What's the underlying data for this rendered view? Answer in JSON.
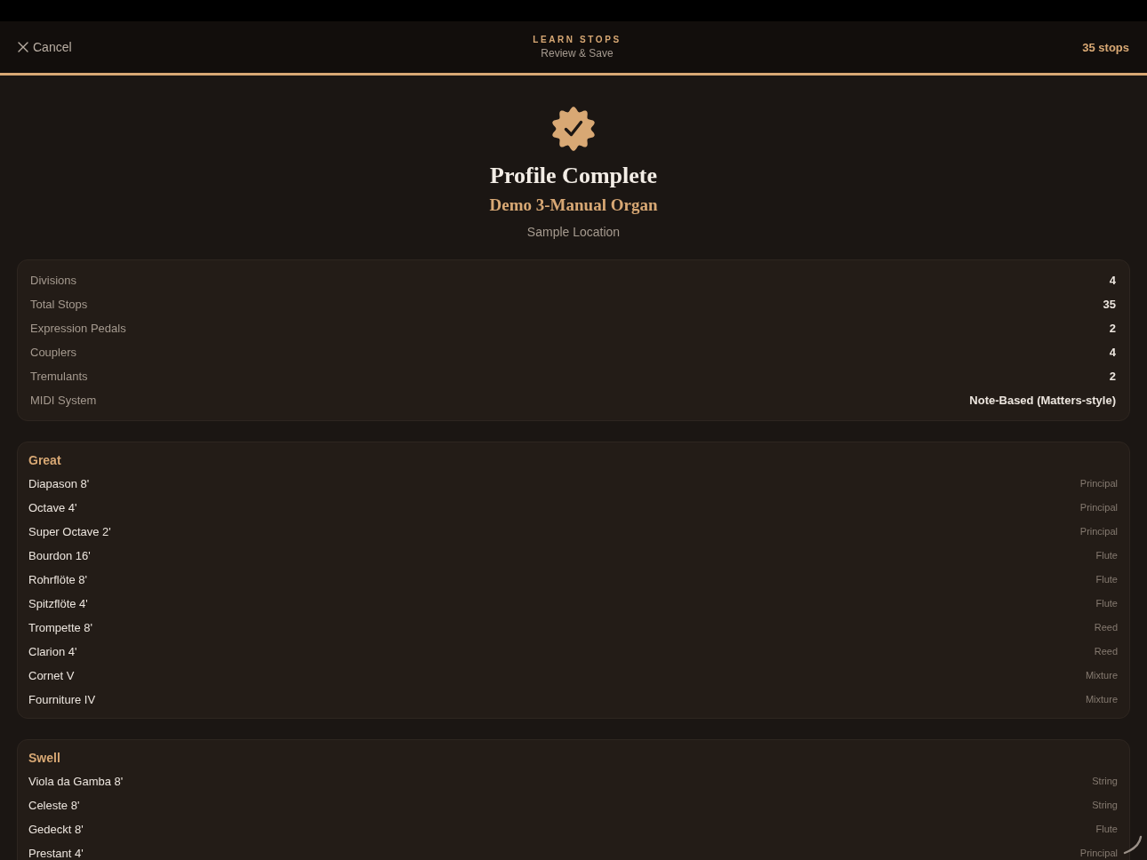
{
  "header": {
    "cancel": "Cancel",
    "title": "LEARN STOPS",
    "subtitle": "Review & Save",
    "count": "35 stops"
  },
  "hero": {
    "title": "Profile Complete",
    "organ_name": "Demo 3-Manual Organ",
    "location": "Sample Location"
  },
  "summary": [
    {
      "label": "Divisions",
      "value": "4"
    },
    {
      "label": "Total Stops",
      "value": "35"
    },
    {
      "label": "Expression Pedals",
      "value": "2"
    },
    {
      "label": "Couplers",
      "value": "4"
    },
    {
      "label": "Tremulants",
      "value": "2"
    },
    {
      "label": "MIDI System",
      "value": "Note-Based (Matters-style)"
    }
  ],
  "divisions": [
    {
      "name": "Great",
      "stops": [
        {
          "name": "Diapason 8'",
          "family": "Principal"
        },
        {
          "name": "Octave 4'",
          "family": "Principal"
        },
        {
          "name": "Super Octave 2'",
          "family": "Principal"
        },
        {
          "name": "Bourdon 16'",
          "family": "Flute"
        },
        {
          "name": "Rohrflöte 8'",
          "family": "Flute"
        },
        {
          "name": "Spitzflöte 4'",
          "family": "Flute"
        },
        {
          "name": "Trompette 8'",
          "family": "Reed"
        },
        {
          "name": "Clarion 4'",
          "family": "Reed"
        },
        {
          "name": "Cornet V",
          "family": "Mixture"
        },
        {
          "name": "Fourniture IV",
          "family": "Mixture"
        }
      ]
    },
    {
      "name": "Swell",
      "stops": [
        {
          "name": "Viola da Gamba 8'",
          "family": "String"
        },
        {
          "name": "Celeste 8'",
          "family": "String"
        },
        {
          "name": "Gedeckt 8'",
          "family": "Flute"
        },
        {
          "name": "Prestant 4'",
          "family": "Principal"
        }
      ]
    }
  ]
}
